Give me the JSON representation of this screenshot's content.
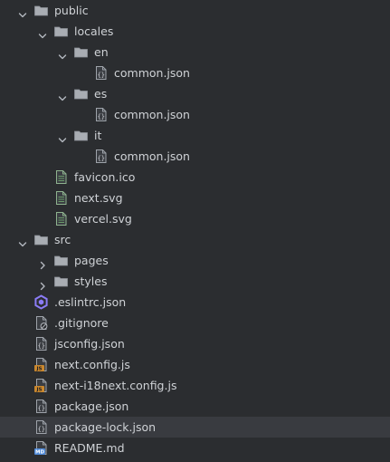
{
  "tree": {
    "items": [
      {
        "label": "public",
        "type": "folder",
        "depth": 0,
        "expanded": true
      },
      {
        "label": "locales",
        "type": "folder",
        "depth": 1,
        "expanded": true
      },
      {
        "label": "en",
        "type": "folder",
        "depth": 2,
        "expanded": true
      },
      {
        "label": "common.json",
        "type": "json",
        "depth": 3
      },
      {
        "label": "es",
        "type": "folder",
        "depth": 2,
        "expanded": true
      },
      {
        "label": "common.json",
        "type": "json",
        "depth": 3
      },
      {
        "label": "it",
        "type": "folder",
        "depth": 2,
        "expanded": true
      },
      {
        "label": "common.json",
        "type": "json",
        "depth": 3
      },
      {
        "label": "favicon.ico",
        "type": "text",
        "depth": 1
      },
      {
        "label": "next.svg",
        "type": "text",
        "depth": 1
      },
      {
        "label": "vercel.svg",
        "type": "text",
        "depth": 1
      },
      {
        "label": "src",
        "type": "folder",
        "depth": 0,
        "expanded": true
      },
      {
        "label": "pages",
        "type": "folder",
        "depth": 1,
        "expanded": false
      },
      {
        "label": "styles",
        "type": "folder",
        "depth": 1,
        "expanded": false
      },
      {
        "label": ".eslintrc.json",
        "type": "eslint",
        "depth": 0
      },
      {
        "label": ".gitignore",
        "type": "ignore",
        "depth": 0
      },
      {
        "label": "jsconfig.json",
        "type": "json",
        "depth": 0
      },
      {
        "label": "next.config.js",
        "type": "js",
        "depth": 0
      },
      {
        "label": "next-i18next.config.js",
        "type": "js",
        "depth": 0
      },
      {
        "label": "package.json",
        "type": "json",
        "depth": 0
      },
      {
        "label": "package-lock.json",
        "type": "json",
        "depth": 0,
        "selected": true
      },
      {
        "label": "README.md",
        "type": "md",
        "depth": 0
      }
    ]
  },
  "icons": {
    "folder": "folder-icon",
    "json": "json-file-icon",
    "text": "text-file-icon",
    "eslint": "eslint-icon",
    "ignore": "gitignore-file-icon",
    "js": "javascript-file-icon",
    "md": "markdown-file-icon",
    "chevron_expanded": "chevron-down-icon",
    "chevron_collapsed": "chevron-right-icon"
  },
  "icon_text": {
    "js": "JS",
    "md": "MD"
  },
  "colors": {
    "background": "#2b2d30",
    "selected_row": "#393b40",
    "text": "#cfd2d6",
    "folder": "#a9adb3",
    "js_badge": "#c9872e",
    "md_badge": "#4f8ad9",
    "eslint": "#8b7cf6",
    "file_green": "#6a9b6a"
  }
}
